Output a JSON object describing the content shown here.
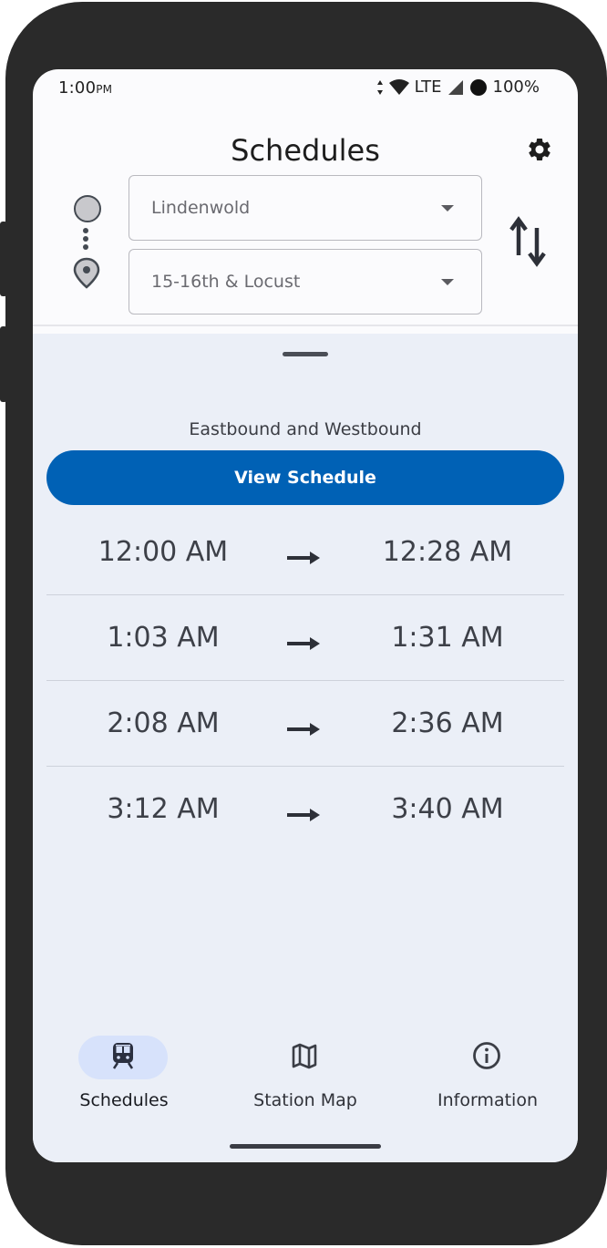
{
  "status_bar": {
    "time": "1:00",
    "ampm": "PM",
    "network": "LTE",
    "battery": "100%"
  },
  "header": {
    "title": "Schedules",
    "settings_icon": "gear-icon",
    "from_station": "Lindenwold",
    "to_station": "15-16th & Locust",
    "swap_icon": "swap-vertical-icon"
  },
  "sheet": {
    "direction_label": "Eastbound and Westbound",
    "view_schedule_label": "View Schedule",
    "trips": [
      {
        "depart": "12:00 AM",
        "arrive": "12:28 AM"
      },
      {
        "depart": "1:03 AM",
        "arrive": "1:31 AM"
      },
      {
        "depart": "2:08 AM",
        "arrive": "2:36 AM"
      },
      {
        "depart": "3:12 AM",
        "arrive": "3:40 AM"
      }
    ]
  },
  "nav": {
    "items": [
      {
        "label": "Schedules",
        "icon": "train-icon",
        "active": true
      },
      {
        "label": "Station Map",
        "icon": "map-icon",
        "active": false
      },
      {
        "label": "Information",
        "icon": "info-icon",
        "active": false
      }
    ]
  },
  "colors": {
    "accent": "#0061b5",
    "sheet_background": "#ebeff7",
    "active_nav_pill": "#d7e2fb"
  }
}
